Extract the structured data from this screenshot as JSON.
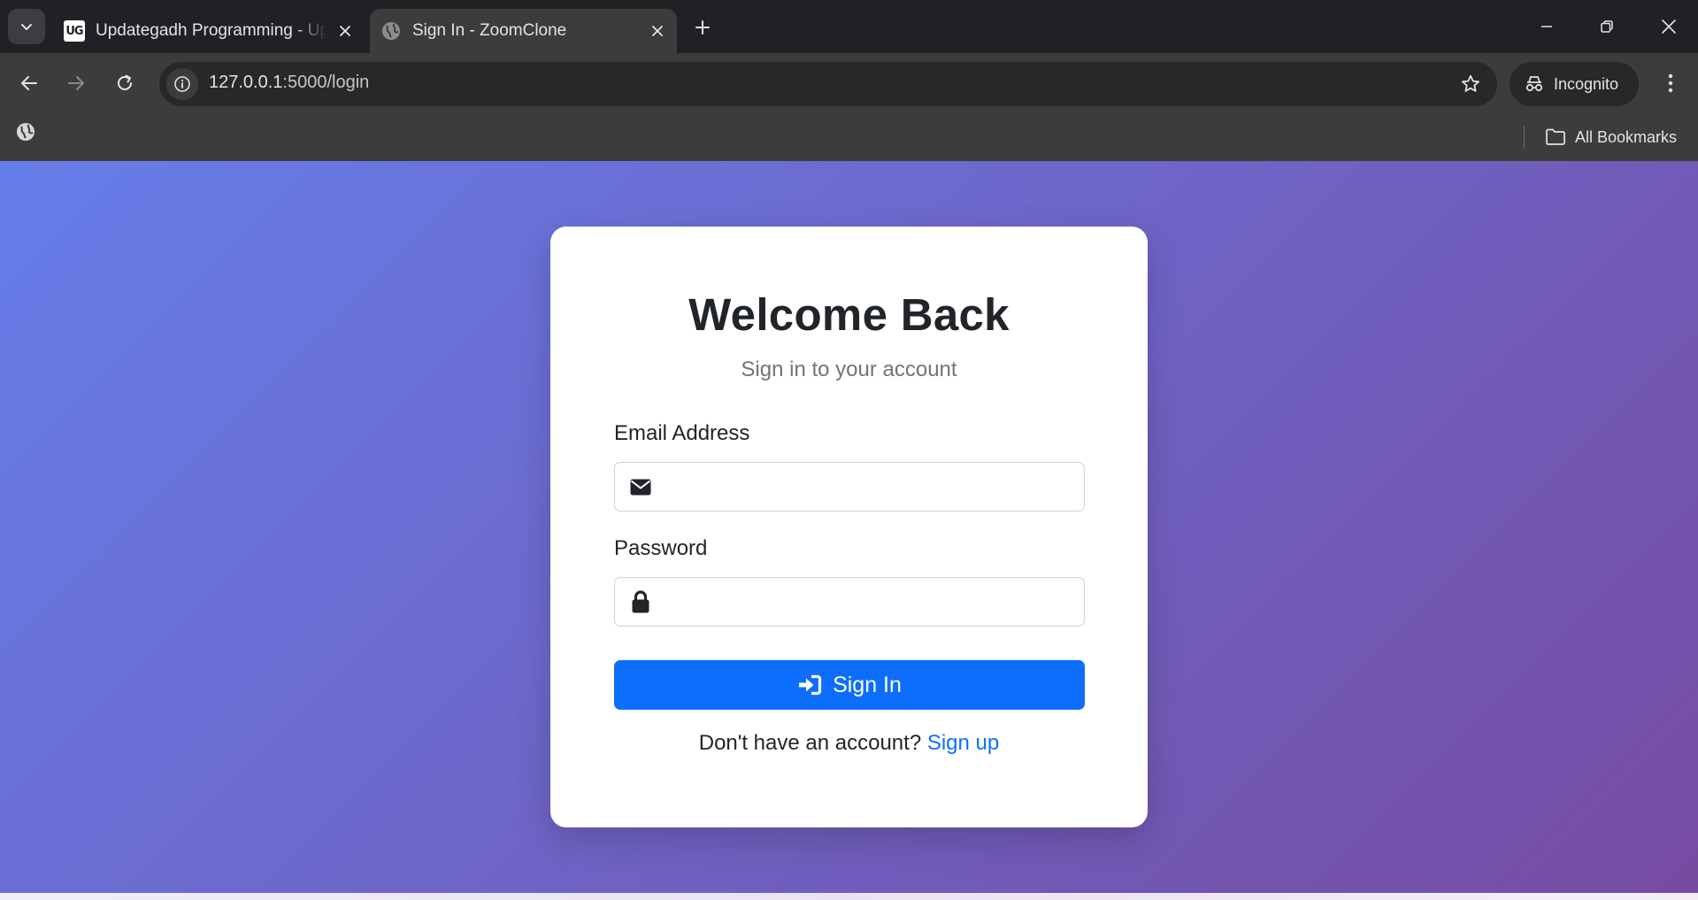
{
  "browser": {
    "tabs": [
      {
        "title": "Updategadh Programming - Up",
        "favicon": "UG",
        "active": false
      },
      {
        "title": "Sign In - ZoomClone",
        "favicon": "globe-icon",
        "active": true
      }
    ],
    "url": {
      "host": "127.0.0.1",
      "path": ":5000/login"
    },
    "incognito_label": "Incognito",
    "bookmarks": {
      "all_bookmarks_label": "All Bookmarks"
    }
  },
  "login": {
    "title": "Welcome Back",
    "subtitle": "Sign in to your account",
    "email_label": "Email Address",
    "email_value": "",
    "password_label": "Password",
    "password_value": "",
    "submit_label": "Sign In",
    "signup_prompt": "Don't have an account?",
    "signup_link": "Sign up"
  },
  "colors": {
    "gradient_start": "#667eea",
    "gradient_end": "#764ba2",
    "primary": "#0d6efd",
    "card_background": "#ffffff"
  }
}
